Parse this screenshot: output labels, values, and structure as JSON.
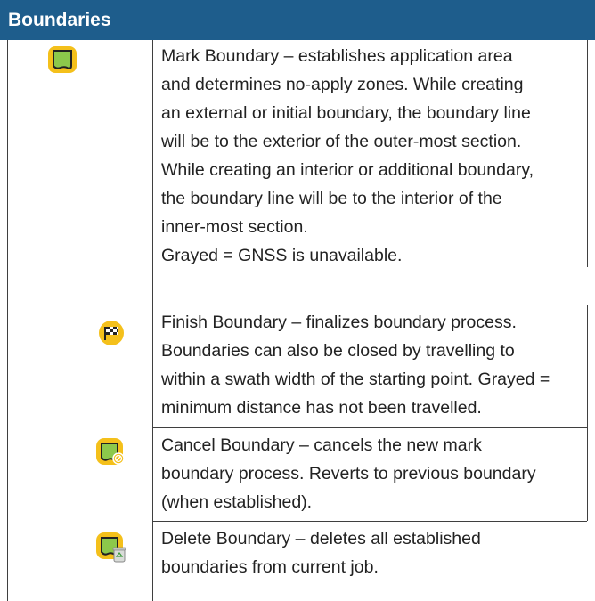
{
  "section": {
    "title": "Boundaries",
    "header_color": "#1e5d8c",
    "icon_accent": "#f4c01b",
    "icon_green": "#8cc84b"
  },
  "rows": [
    {
      "icon": "mark-boundary-icon",
      "lines": [
        "Mark Boundary – establishes application area",
        "and determines no-apply zones. While creating",
        "an external or initial boundary, the boundary line",
        "will be to the exterior of the outer-most section.",
        "While creating an interior or additional boundary,",
        "the boundary line will be to the interior of the",
        "inner-most section.",
        "Grayed = GNSS is unavailable."
      ]
    },
    {
      "icon": "finish-boundary-checkered-flag-icon",
      "lines": [
        "Finish Boundary – finalizes boundary process.",
        "Boundaries can also be closed by travelling to",
        "within a swath width of the starting point. Grayed =",
        "minimum distance has not been travelled."
      ]
    },
    {
      "icon": "cancel-boundary-icon",
      "lines": [
        "Cancel Boundary – cancels the new mark",
        "boundary process. Reverts to previous boundary",
        "(when established)."
      ]
    },
    {
      "icon": "delete-boundary-trash-icon",
      "lines": [
        "Delete Boundary – deletes all established",
        "boundaries from current job."
      ]
    }
  ]
}
